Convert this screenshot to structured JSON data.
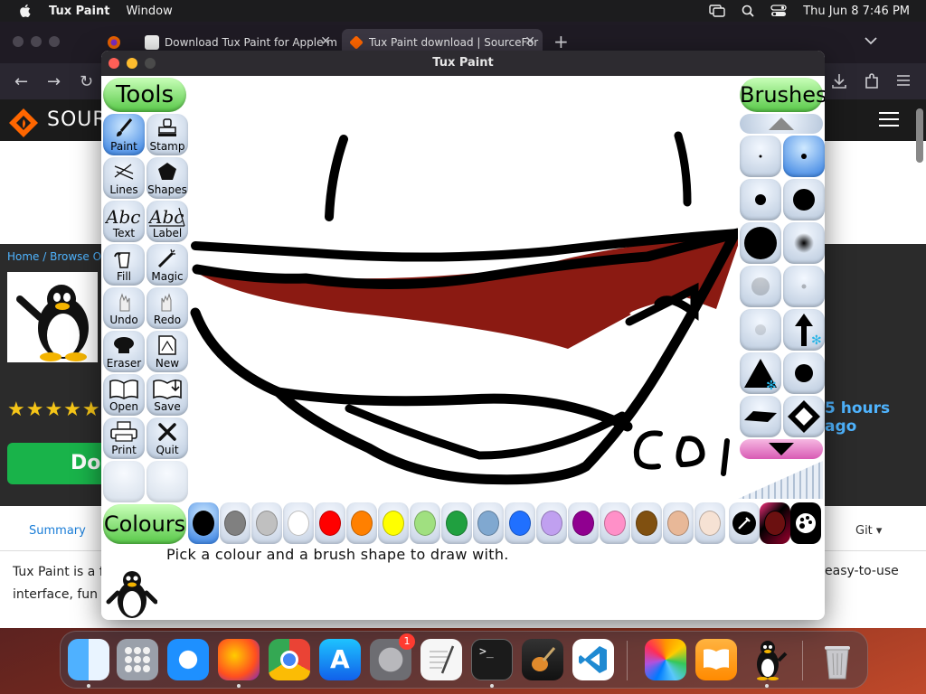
{
  "menubar": {
    "app_name": "Tux Paint",
    "menus": [
      "Window"
    ],
    "clock": "Thu Jun 8  7:46 PM"
  },
  "browser": {
    "tabs": [
      {
        "title": "Download Tux Paint for Apple m",
        "active": false
      },
      {
        "title": "Tux Paint download | SourceFor",
        "active": true
      }
    ],
    "new_tab": "+",
    "site_name": "SOUR",
    "breadcrumb": "Home / Browse Ope",
    "updated_text": "5 hours ago",
    "download_button": "Do",
    "nav_summary": "Summary",
    "nav_git": "Git",
    "body_left": [
      "Tux Paint is a f",
      "interface, fun"
    ],
    "body_right": "easy-to-use"
  },
  "tuxpaint": {
    "window_title": "Tux Paint",
    "tools_header": "Tools",
    "brushes_header": "Brushes",
    "colours_header": "Colours",
    "tools": [
      {
        "label": "Paint",
        "icon": "paintbrush-icon",
        "selected": true
      },
      {
        "label": "Stamp",
        "icon": "stamp-icon",
        "selected": false
      },
      {
        "label": "Lines",
        "icon": "lines-icon",
        "selected": false
      },
      {
        "label": "Shapes",
        "icon": "pentagon-icon",
        "selected": false
      },
      {
        "label": "Text",
        "icon": "text-abc-icon",
        "selected": false
      },
      {
        "label": "Label",
        "icon": "label-abc-icon",
        "selected": false
      },
      {
        "label": "Fill",
        "icon": "paint-bucket-icon",
        "selected": false
      },
      {
        "label": "Magic",
        "icon": "magic-wand-icon",
        "selected": false
      },
      {
        "label": "Undo",
        "icon": "undo-hand-icon",
        "selected": false
      },
      {
        "label": "Redo",
        "icon": "redo-hand-icon",
        "selected": false
      },
      {
        "label": "Eraser",
        "icon": "eraser-icon",
        "selected": false
      },
      {
        "label": "New",
        "icon": "new-page-icon",
        "selected": false
      },
      {
        "label": "Open",
        "icon": "open-book-icon",
        "selected": false
      },
      {
        "label": "Save",
        "icon": "save-book-icon",
        "selected": false
      },
      {
        "label": "Print",
        "icon": "printer-icon",
        "selected": false
      },
      {
        "label": "Quit",
        "icon": "quit-x-icon",
        "selected": false
      }
    ],
    "brush_names": [
      "tiny-dot",
      "small-dot-selected",
      "medium-dot",
      "large-dot",
      "huge-dot",
      "fuzzy-dot",
      "faded-dot",
      "faint-dot",
      "light-dot",
      "arrow-up",
      "triangle",
      "round-dot",
      "diamond-flat",
      "diamond-arrows"
    ],
    "colours": [
      "#000000",
      "#808080",
      "#c0c0c0",
      "#ffffff",
      "#ff0000",
      "#ff8000",
      "#ffff00",
      "#a0e080",
      "#20a040",
      "#80a8d0",
      "#2070ff",
      "#c0a0f0",
      "#900090",
      "#ff90c8",
      "#805010",
      "#e8b898",
      "#f6e2d4"
    ],
    "tip": "Pick a colour and a brush shape to draw with."
  },
  "dock": {
    "apps": [
      "finder-icon",
      "launchpad-icon",
      "safari-icon",
      "firefox-icon",
      "chrome-icon",
      "app-store-icon",
      "system-settings-icon",
      "textedit-icon",
      "terminal-icon",
      "garageband-icon",
      "vscode-icon",
      "photos-icon",
      "books-icon",
      "tuxpaint-icon",
      "trash-icon"
    ],
    "settings_badge": "1"
  }
}
